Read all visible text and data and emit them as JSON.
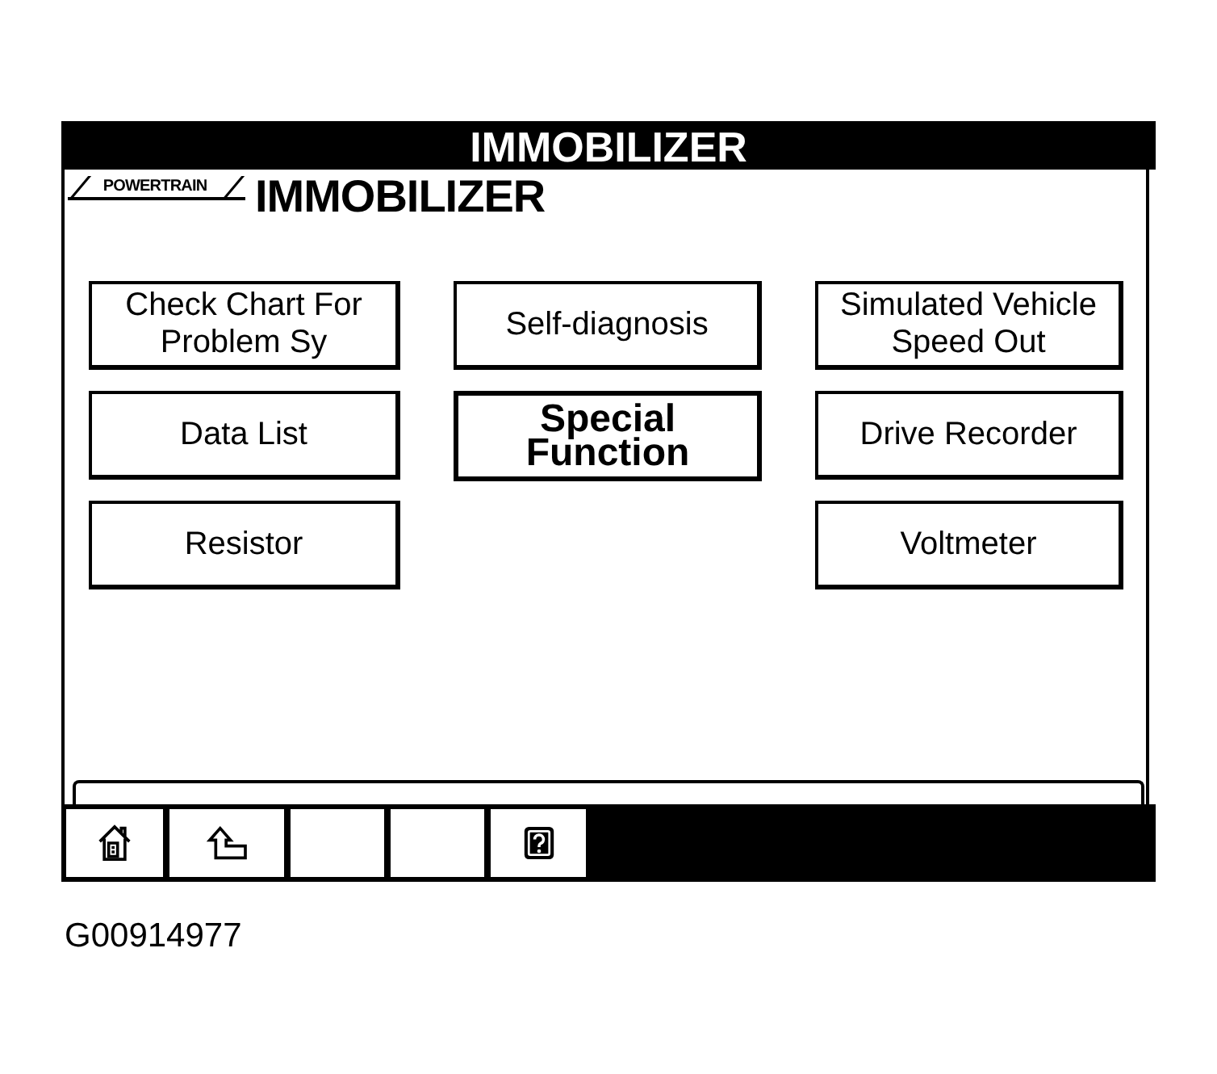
{
  "window": {
    "title": "IMMOBILIZER"
  },
  "header": {
    "tag": "POWERTRAIN",
    "title": "IMMOBILIZER"
  },
  "menu": {
    "columns": [
      [
        {
          "label": "Check Chart For Problem Sy",
          "selected": false
        },
        {
          "label": "Data List",
          "selected": false
        },
        {
          "label": "Resistor",
          "selected": false
        }
      ],
      [
        {
          "label": "Self-diagnosis",
          "selected": false
        },
        {
          "label": "Special Function",
          "selected": true
        }
      ],
      [
        {
          "label": "Simulated Vehicle Speed Out",
          "selected": false
        },
        {
          "label": "Drive Recorder",
          "selected": false
        },
        {
          "label": "Voltmeter",
          "selected": false
        }
      ]
    ]
  },
  "toolbar": [
    {
      "kind": "home"
    },
    {
      "kind": "back"
    },
    {
      "kind": "blank"
    },
    {
      "kind": "blank"
    },
    {
      "kind": "help"
    }
  ],
  "figure_id": "G00914977"
}
